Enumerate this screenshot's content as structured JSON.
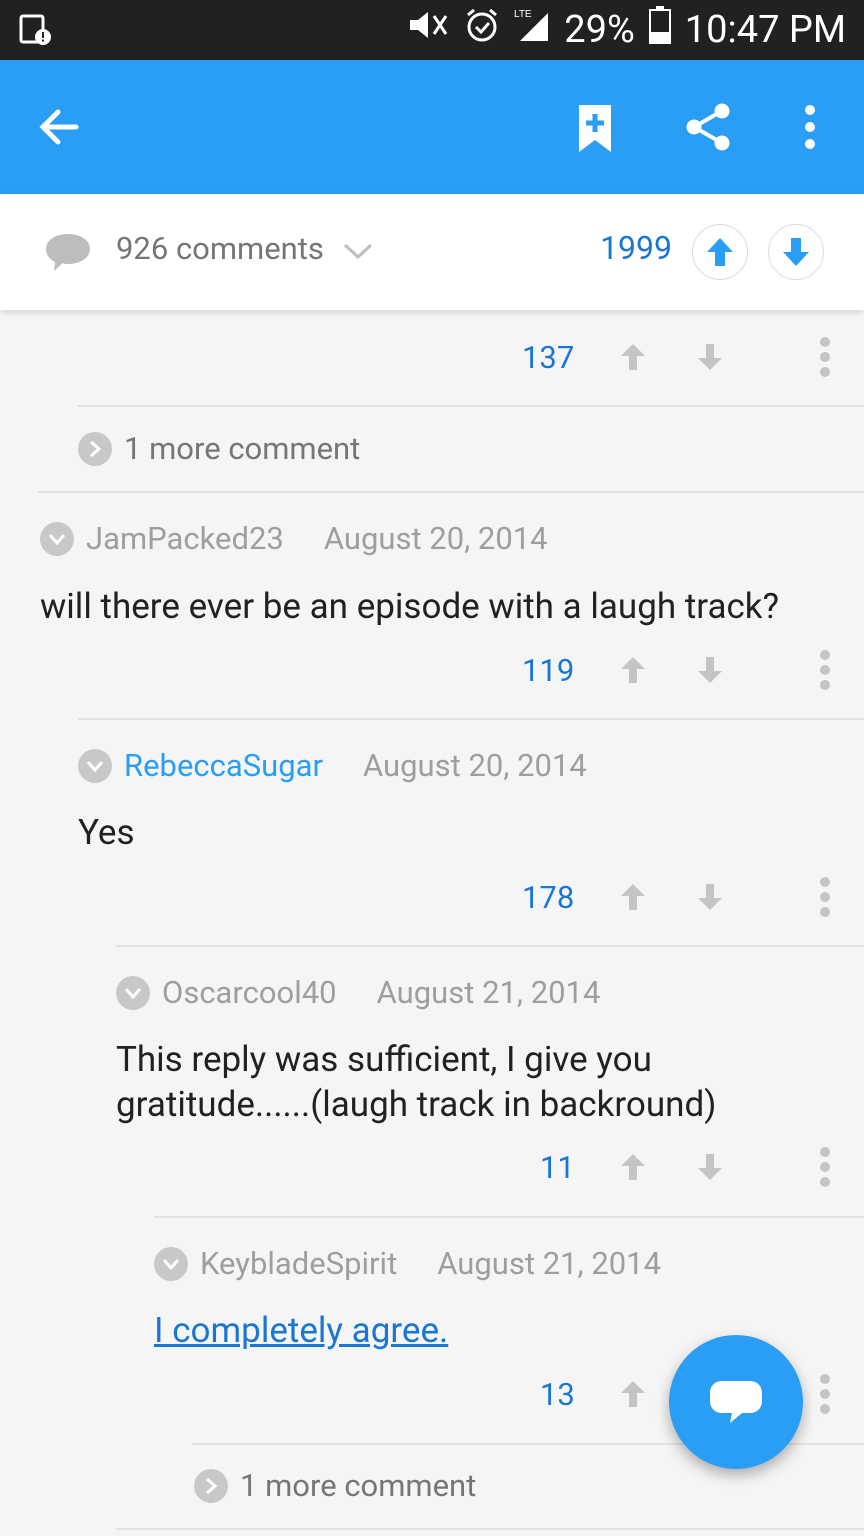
{
  "status_bar": {
    "battery": "29%",
    "time": "10:47 PM",
    "network": "LTE"
  },
  "app_bar": {
    "icons": [
      "back-arrow-icon",
      "bookmark-add-icon",
      "share-icon",
      "overflow-menu-icon"
    ]
  },
  "post_bar": {
    "comments_label": "926 comments",
    "score": "1999"
  },
  "comments": [
    {
      "points": "137"
    },
    {
      "more_label": "1 more comment"
    },
    {
      "author": "JamPacked23",
      "date": "August 20, 2014",
      "body": "will there ever be an episode with a laugh track?",
      "points": "119"
    },
    {
      "author": "RebeccaSugar",
      "date": "August 20, 2014",
      "body": "Yes",
      "points": "178",
      "is_op": true
    },
    {
      "author": "Oscarcool40",
      "date": "August 21, 2014",
      "body_line1": "This reply was sufficient, I give you",
      "body_line2": "gratitude......(laugh track in backround)",
      "points": "11"
    },
    {
      "author": "KeybladeSpirit",
      "date": "August 21, 2014",
      "body": "I completely agree.",
      "points": "13"
    },
    {
      "more_label": "1 more comment"
    }
  ],
  "colors": {
    "accent": "#2a9df4",
    "link_blue": "#1976d2",
    "status_bar_bg": "#212121"
  }
}
